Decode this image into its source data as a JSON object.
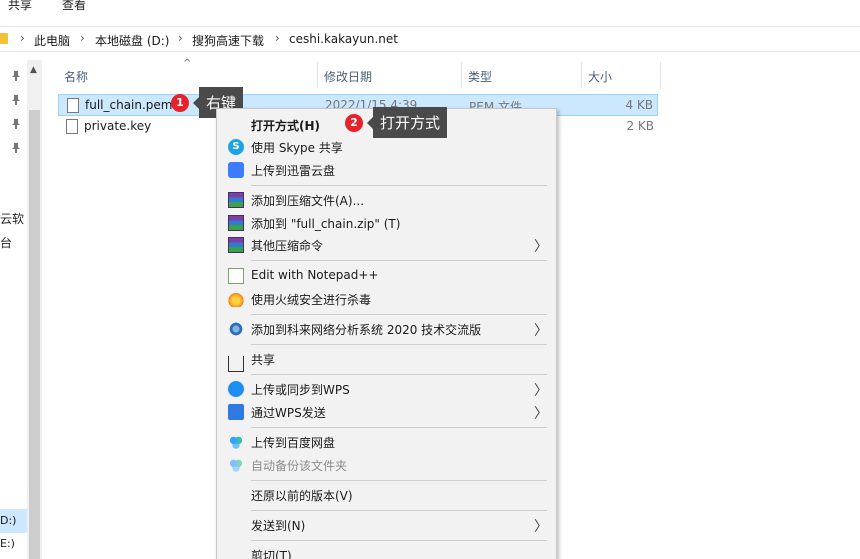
{
  "ribbon": {
    "tabs": [
      "共享",
      "查看"
    ]
  },
  "breadcrumb": [
    "此电脑",
    "本地磁盘 (D:)",
    "搜狗高速下载",
    "ceshi.kakayun.net"
  ],
  "nav": {
    "fragments": [
      "云软",
      "台"
    ],
    "drive_selected": "D:)",
    "drive_other": "E:)"
  },
  "columns": {
    "name": "名称",
    "date": "修改日期",
    "type": "类型",
    "size": "大小"
  },
  "files": [
    {
      "name": "full_chain.pem",
      "date": "2022/1/15 4:39",
      "type": "PEM 文件",
      "size": "4 KB",
      "selected": true
    },
    {
      "name": "private.key",
      "date": "",
      "type": "",
      "size": "2 KB",
      "selected": false
    }
  ],
  "annotations": [
    {
      "num": "1",
      "text": "右键"
    },
    {
      "num": "2",
      "text": "打开方式"
    }
  ],
  "context_menu": [
    {
      "label": "打开方式(H)",
      "icon": "none",
      "bold": true
    },
    {
      "label": "使用 Skype 共享",
      "icon": "skype-icon"
    },
    {
      "label": "上传到迅雷云盘",
      "icon": "thunder-icon"
    },
    {
      "label": "添加到压缩文件(A)...",
      "icon": "winrar-icon"
    },
    {
      "label": "添加到 \"full_chain.zip\" (T)",
      "icon": "winrar-icon"
    },
    {
      "label": "其他压缩命令",
      "icon": "winrar-icon",
      "submenu": true
    },
    {
      "label": "Edit with Notepad++",
      "icon": "notepad-icon"
    },
    {
      "label": "使用火绒安全进行杀毒",
      "icon": "huorong-icon"
    },
    {
      "label": "添加到科来网络分析系统 2020 技术交流版",
      "icon": "kelai-icon",
      "submenu": true
    },
    {
      "label": "共享",
      "icon": "share-icon"
    },
    {
      "label": "上传或同步到WPS",
      "icon": "wps-cloud-icon",
      "submenu": true
    },
    {
      "label": "通过WPS发送",
      "icon": "wps-send-icon",
      "submenu": true
    },
    {
      "label": "上传到百度网盘",
      "icon": "baidu-icon"
    },
    {
      "label": "自动备份该文件夹",
      "icon": "baidu-icon",
      "disabled": true
    },
    {
      "label": "还原以前的版本(V)",
      "icon": "none"
    },
    {
      "label": "发送到(N)",
      "icon": "none",
      "submenu": true
    },
    {
      "label": "剪切(T)",
      "icon": "none"
    }
  ],
  "submenu_glyph": "〉"
}
